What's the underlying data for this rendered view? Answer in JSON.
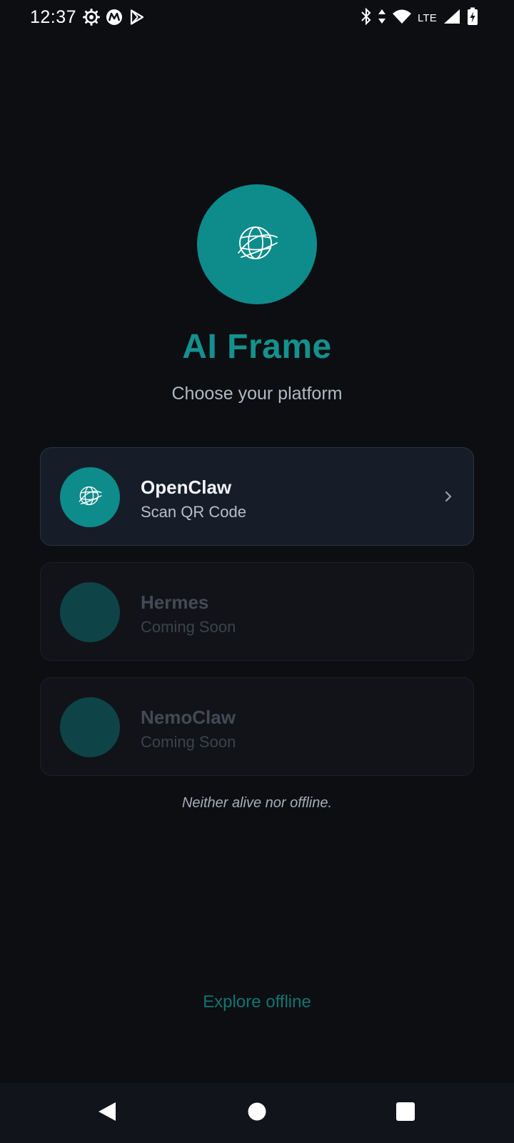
{
  "status_bar": {
    "time": "12:37",
    "network_label": "LTE",
    "left_icons": [
      "settings-gear-icon",
      "motorola-logo-icon",
      "play-store-icon"
    ],
    "right_icons": [
      "bluetooth-icon",
      "data-arrows-icon",
      "wifi-icon",
      "signal-icon",
      "battery-charging-icon"
    ]
  },
  "app": {
    "title": "AI Frame",
    "subtitle": "Choose your platform",
    "logo_icon": "globe-icon"
  },
  "platforms": [
    {
      "name": "OpenClaw",
      "subtitle": "Scan QR Code",
      "enabled": true,
      "icon": "globe-icon"
    },
    {
      "name": "Hermes",
      "subtitle": "Coming Soon",
      "enabled": false,
      "icon": "empty-circle"
    },
    {
      "name": "NemoClaw",
      "subtitle": "Coming Soon",
      "enabled": false,
      "icon": "empty-circle"
    }
  ],
  "tagline": "Neither alive nor offline.",
  "explore_label": "Explore offline",
  "colors": {
    "background": "#0c0e12",
    "accent": "#0e8b8b",
    "accent_text": "#14918e",
    "card_active": "#161d28",
    "card_disabled": "#111318",
    "disabled_icon": "#0e4447",
    "link": "#0f7571",
    "nav_bar": "#12141b"
  },
  "nav_bar": {
    "buttons": [
      "back-icon",
      "home-icon",
      "recents-icon"
    ]
  }
}
